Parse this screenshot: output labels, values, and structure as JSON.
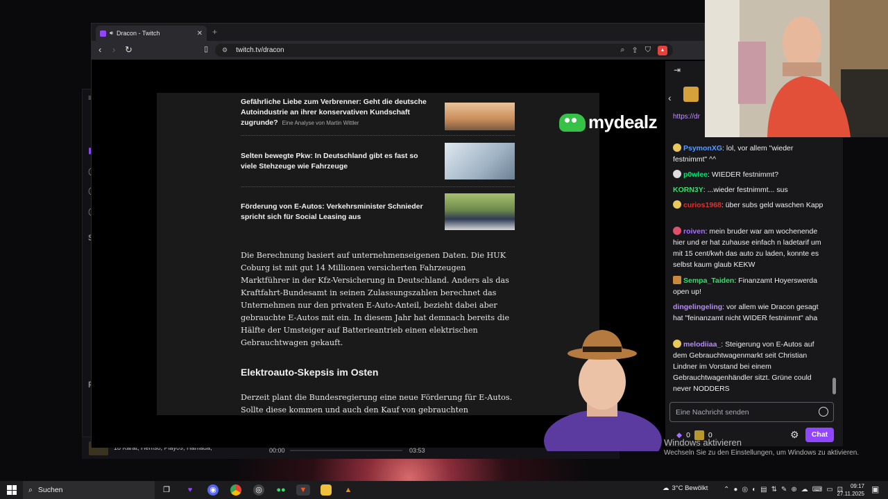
{
  "browser": {
    "tab_title": "Dracon - Twitch",
    "url": "twitch.tv/dracon",
    "new_tab": "+",
    "brave_count": "1"
  },
  "article": {
    "related": [
      {
        "title": "Gefährliche Liebe zum Verbrenner: Geht die deutsche Autoindustrie an ihrer konservativen Kundschaft zugrunde?",
        "source": "Eine Analyse von Martin Wittler"
      },
      {
        "title": "Selten bewegte Pkw: In Deutschland gibt es fast so viele Stehzeuge wie Fahrzeuge",
        "source": ""
      },
      {
        "title": "Förderung von E-Autos: Verkehrsminister Schnieder spricht sich für Social Leasing aus",
        "source": ""
      }
    ],
    "paragraph1": "Die Berechnung basiert auf unternehmenseigenen Daten. Die HUK Coburg ist mit gut 14 Millionen versicherten Fahrzeugen Marktführer in der Kfz-Versicherung in Deutschland. Anders als das Kraftfahrt-Bundesamt in seinen Zulassungszahlen berechnet das Unternehmen nur den privaten E-Auto-Anteil, bezieht dabei aber gebrauchte E-Autos mit ein. In diesem Jahr hat demnach bereits die Hälfte der Umsteiger auf Batterieantrieb einen elektrischen Gebrauchtwagen gekauft.",
    "heading": "Elektroauto-Skepsis im Osten",
    "paragraph2": "Derzeit plant die Bundesregierung eine neue Förderung für E-Autos. Sollte diese kommen und auch den Kauf von gebrauchten Batterieautos"
  },
  "overlay": {
    "sponsor_word": "mydealz"
  },
  "background_player": {
    "viewers_line": "18 Karat, Hemso, Play09, Hamada,",
    "time_start": "00:00",
    "time_end": "03:53"
  },
  "chat": {
    "link": "https://dr",
    "messages": [
      {
        "user": "PsymonXG",
        "color": "#5c9bff",
        "text": ": lol, vor allem \"wieder festnimmt\" ^^"
      },
      {
        "user": "p0wlee",
        "color": "#00e676",
        "text": ": WIEDER festnimmt?"
      },
      {
        "user": "KORN3Y",
        "color": "#33e06a",
        "text": ": ...wieder festnimmt... sus"
      },
      {
        "user": "curios1968",
        "color": "#e03030",
        "text": ": über subs geld waschen Kapp"
      },
      {
        "user": "roiven",
        "color": "#a970ff",
        "text": ": mein bruder war am wochenende hier und er hat zuhause einfach n ladetarif um mit 15 cent/kwh das auto zu laden, konnte es selbst kaum glaub KEKW"
      },
      {
        "user": "Sempa_Taiden",
        "color": "#33e06a",
        "text": ": Finanzamt Hoyerswerda open up!"
      },
      {
        "user": "dingelingeling",
        "color": "#b98aff",
        "text": ": vor allem wie Dracon gesagt hat \"feinanzamt nicht WIDER festnimmt\" aha"
      },
      {
        "user": "melodiiaa_",
        "color": "#b98aff",
        "text": ": Steigerung von E-Autos auf dem Gebrauchtwagenmarkt seit Christian Lindner im Vorstand bei einem Gebrauchtwagenhändler sitzt. Grüne could never NODDERS"
      }
    ],
    "input_placeholder": "Eine Nachricht senden",
    "bits": "0",
    "points": "0",
    "send_label": "Chat"
  },
  "windows_activation": {
    "title": "Windows aktivieren",
    "subtitle": "Wechseln Sie zu den Einstellungen, um Windows zu aktivieren."
  },
  "taskbar": {
    "search_label": "Suchen",
    "weather": "3°C  Bewölkt",
    "time": "09:17",
    "date": "27.11.2025"
  }
}
